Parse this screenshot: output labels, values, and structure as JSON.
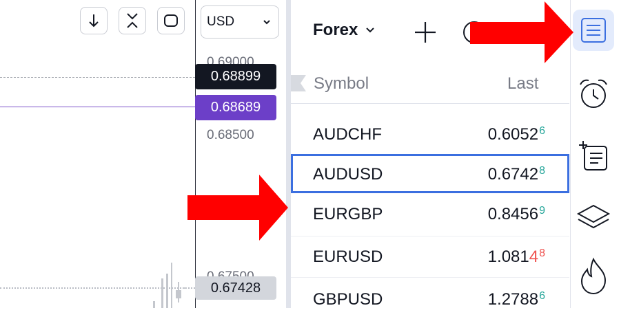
{
  "toolbar": {
    "currency": "USD",
    "buttons": [
      "scroll-down-icon",
      "collapse-icon",
      "fullscreen-icon"
    ]
  },
  "price_scale": {
    "labels": [
      "0.69000",
      "0.68500",
      "0.67500"
    ],
    "tags": [
      {
        "value": "0.68899",
        "color": "#131722"
      },
      {
        "value": "0.68689",
        "color": "#6c3fc8"
      },
      {
        "value": "0.67428",
        "color": "#d3d6dc"
      }
    ]
  },
  "watchlist": {
    "title": "Forex",
    "col_symbol": "Symbol",
    "col_last": "Last",
    "rows": [
      {
        "symbol": "AUDCHF",
        "main": "0.6052",
        "tail_plain": "",
        "tail_colored": "6",
        "dir": "up"
      },
      {
        "symbol": "AUDUSD",
        "main": "0.6742",
        "tail_plain": "",
        "tail_colored": "8",
        "dir": "up",
        "selected": true
      },
      {
        "symbol": "EURGBP",
        "main": "0.8456",
        "tail_plain": "",
        "tail_colored": "9",
        "dir": "up"
      },
      {
        "symbol": "EURUSD",
        "main": "1.081",
        "tail_plain": "4",
        "tail_colored": "8",
        "dir": "down"
      },
      {
        "symbol": "GBPUSD",
        "main": "1.2788",
        "tail_plain": "",
        "tail_colored": "6",
        "dir": "up"
      }
    ]
  },
  "right_toolbar": [
    "watchlist-icon",
    "alarm-clock-icon",
    "add-note-icon",
    "layers-icon",
    "hotlist-flame-icon"
  ],
  "colors": {
    "accent": "#3b6fe0",
    "up": "#26a69a",
    "down": "#ef5350",
    "arrow": "#ff0000"
  }
}
